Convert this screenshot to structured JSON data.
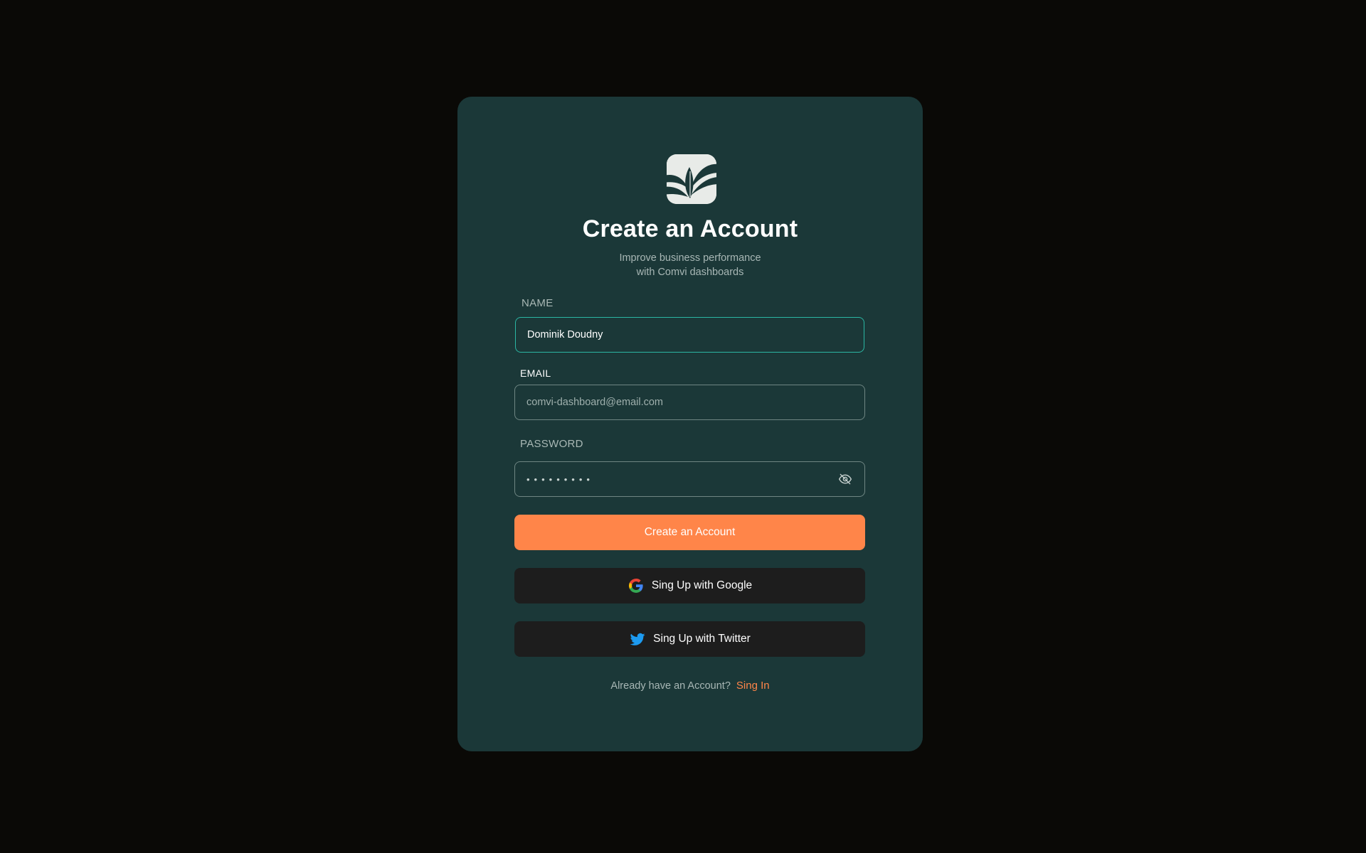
{
  "header": {
    "logo_icon": "leaf-icon",
    "title": "Create an Account",
    "subtitle_line1": "Improve business performance",
    "subtitle_line2": "with Comvi dashboards"
  },
  "form": {
    "name": {
      "label": "NAME",
      "value": "Dominik Doudny"
    },
    "email": {
      "label": "EMAIL",
      "placeholder": "comvi-dashboard@email.com"
    },
    "password": {
      "label": "PASSWORD",
      "masked_value": "•••••••••",
      "toggle_icon": "eye-off-icon"
    },
    "submit_label": "Create an Account",
    "google_label": "Sing Up with Google",
    "twitter_label": "Sing Up with Twitter"
  },
  "footer": {
    "prompt": "Already have an Account?",
    "link_label": "Sing In"
  },
  "colors": {
    "background": "#0a0906",
    "card": "#1b3838",
    "accent": "#ff8549",
    "focus": "#2bb6a3",
    "social_button": "#1d1d1d"
  }
}
